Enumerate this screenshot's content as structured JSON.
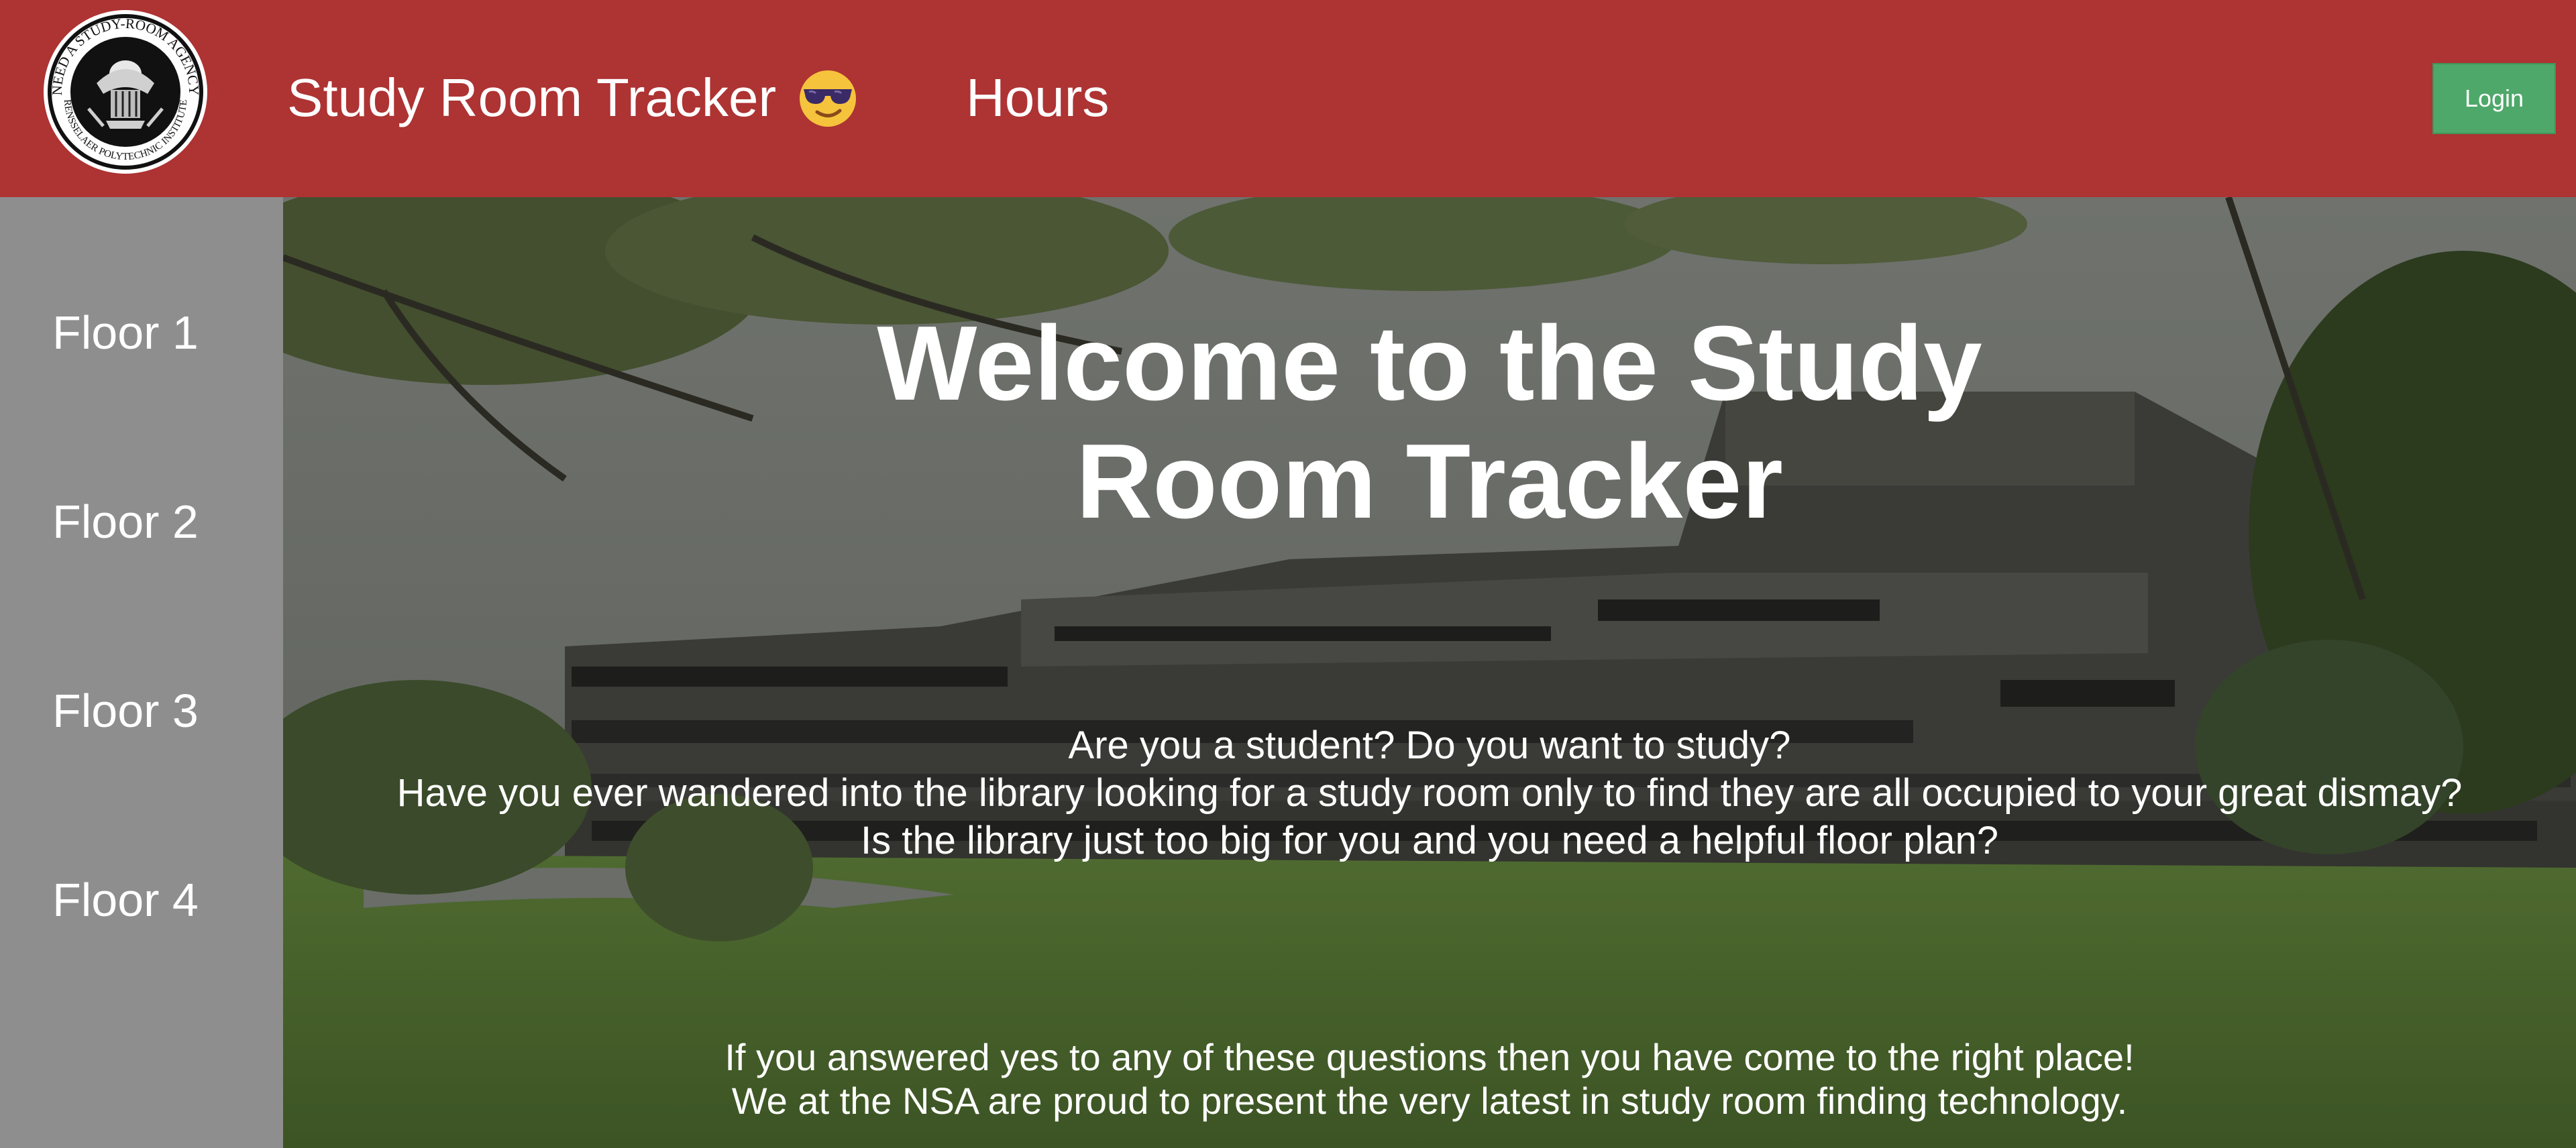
{
  "header": {
    "logo_text": "NEED A STUDY-ROOM AGENCY • RENSSELAER POLYTECHNIC INSTITUTE",
    "brand_title": "Study Room Tracker",
    "emoji_icon": "smiling-face-with-sunglasses-icon",
    "nav_hours": "Hours",
    "login_label": "Login"
  },
  "sidebar": {
    "items": [
      {
        "label": "Floor 1"
      },
      {
        "label": "Floor 2"
      },
      {
        "label": "Floor 3"
      },
      {
        "label": "Floor 4"
      }
    ]
  },
  "hero": {
    "title_line1": "Welcome to the Study",
    "title_line2": "Room Tracker",
    "questions": [
      "Are you a student? Do you want to study?",
      "Have you ever wandered into the library looking for a study room only to find they are all occupied to your great dismay?",
      "Is the library just too big for you and you need a helpful floor plan?"
    ],
    "answers": [
      "If you answered yes to any of these questions then you have come to the right place!",
      "We at the NSA are proud to present the very latest in study room finding technology."
    ]
  },
  "colors": {
    "header_bg": "#ae3333",
    "sidebar_bg": "#8e8e8e",
    "login_bg": "#4ea86a",
    "text": "#ffffff"
  }
}
